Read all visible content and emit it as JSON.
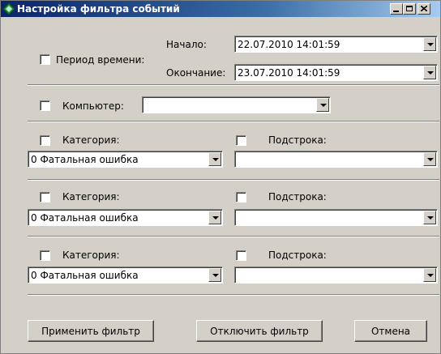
{
  "window": {
    "title": "Настройка фильтра событий",
    "controls": {
      "minimize": "_",
      "maximize": "□",
      "close": "X"
    }
  },
  "time_period": {
    "checkbox_label": "Период времени:",
    "checked": false,
    "start_label": "Начало:",
    "start_value": "22.07.2010 14:01:59",
    "end_label": "Окончание:",
    "end_value": "23.07.2010 14:01:59"
  },
  "computer": {
    "checkbox_label": "Компьютер:",
    "checked": false,
    "value": ""
  },
  "rows": [
    {
      "category_label": "Категория:",
      "category_checked": false,
      "category_value": "0 Фатальная ошибка",
      "substring_label": "Подстрока:",
      "substring_checked": false,
      "substring_value": ""
    },
    {
      "category_label": "Категория:",
      "category_checked": false,
      "category_value": "0 Фатальная ошибка",
      "substring_label": "Подстрока:",
      "substring_checked": false,
      "substring_value": ""
    },
    {
      "category_label": "Категория:",
      "category_checked": false,
      "category_value": "0 Фатальная ошибка",
      "substring_label": "Подстрока:",
      "substring_checked": false,
      "substring_value": ""
    }
  ],
  "buttons": {
    "apply": "Применить фильтр",
    "disable": "Отключить фильтр",
    "cancel": "Отмена"
  },
  "colors": {
    "title_start": "#0a246a",
    "title_end": "#a6caf0",
    "face": "#d4d0c8"
  }
}
